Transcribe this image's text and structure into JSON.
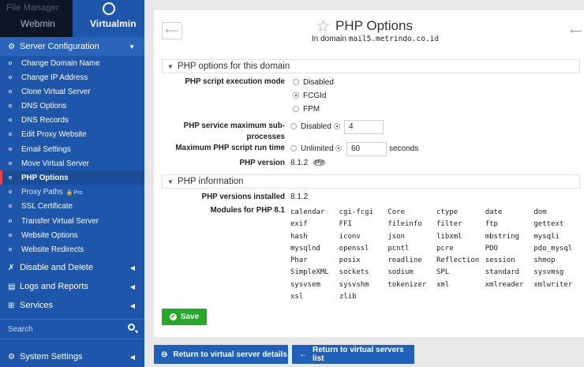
{
  "sidebar": {
    "webmin_ghost": "File Manager",
    "webmin_tab": "Webmin",
    "virtualmin_tab": "Virtualmin",
    "server_config": "Server Configuration",
    "items": [
      {
        "label": "Change Domain Name"
      },
      {
        "label": "Change IP Address"
      },
      {
        "label": "Clone Virtual Server"
      },
      {
        "label": "DNS Options"
      },
      {
        "label": "DNS Records"
      },
      {
        "label": "Edit Proxy Website"
      },
      {
        "label": "Email Settings"
      },
      {
        "label": "Move Virtual Server"
      },
      {
        "label": "PHP Options"
      },
      {
        "label": "Proxy Paths",
        "badge": "Pro"
      },
      {
        "label": "SSL Certificate"
      },
      {
        "label": "Transfer Virtual Server"
      },
      {
        "label": "Website Options"
      },
      {
        "label": "Website Redirects"
      }
    ],
    "disable_delete": "Disable and Delete",
    "logs_reports": "Logs and Reports",
    "services": "Services",
    "search_placeholder": "Search",
    "system_settings": "System Settings"
  },
  "header": {
    "title": "PHP Options",
    "subtitle_prefix": "In domain",
    "domain": "mail5.metrindo.co.id"
  },
  "php_options": {
    "heading": "PHP options for this domain",
    "exec_mode_label": "PHP script execution mode",
    "exec_modes": [
      "Disabled",
      "FCGId",
      "FPM"
    ],
    "exec_mode_selected": "FCGId",
    "max_sub_label_1": "PHP service maximum sub-",
    "max_sub_label_2": "processes",
    "max_sub_disabled": "Disabled",
    "max_sub_value": "4",
    "max_runtime_label": "Maximum PHP script run time",
    "max_runtime_unlimited": "Unlimited",
    "max_runtime_value": "60",
    "max_runtime_unit": "seconds",
    "php_version_label": "PHP version",
    "php_version": "8.1.2",
    "php_badge": "php"
  },
  "php_info": {
    "heading": "PHP information",
    "installed_label": "PHP versions installed",
    "installed": "8.1.2",
    "modules_label": "Modules for PHP 8.1",
    "modules": [
      [
        "calendar",
        "cgi-fcgi",
        "Core",
        "ctype",
        "date",
        "dom"
      ],
      [
        "exif",
        "FFI",
        "fileinfo",
        "filter",
        "ftp",
        "gettext"
      ],
      [
        "hash",
        "iconv",
        "json",
        "libxml",
        "mbstring",
        "mysqli"
      ],
      [
        "mysqlnd",
        "openssl",
        "pcntl",
        "pcre",
        "PDO",
        "pdo_mysql"
      ],
      [
        "Phar",
        "posix",
        "readline",
        "Reflection",
        "session",
        "shmop"
      ],
      [
        "SimpleXML",
        "sockets",
        "sodium",
        "SPL",
        "standard",
        "sysvmsg"
      ],
      [
        "sysvsem",
        "sysvshm",
        "tokenizer",
        "xml",
        "xmlreader",
        "xmlwriter"
      ],
      [
        "xsl",
        "zlib"
      ]
    ]
  },
  "buttons": {
    "save": "Save",
    "return_details": "Return to virtual server details",
    "return_list": "Return to virtual servers list"
  },
  "colors": {
    "sidebar_bg": "#1d56ab",
    "save_green": "#28a828",
    "nav_blue": "#2160b8",
    "active_marker": "#e84545"
  }
}
